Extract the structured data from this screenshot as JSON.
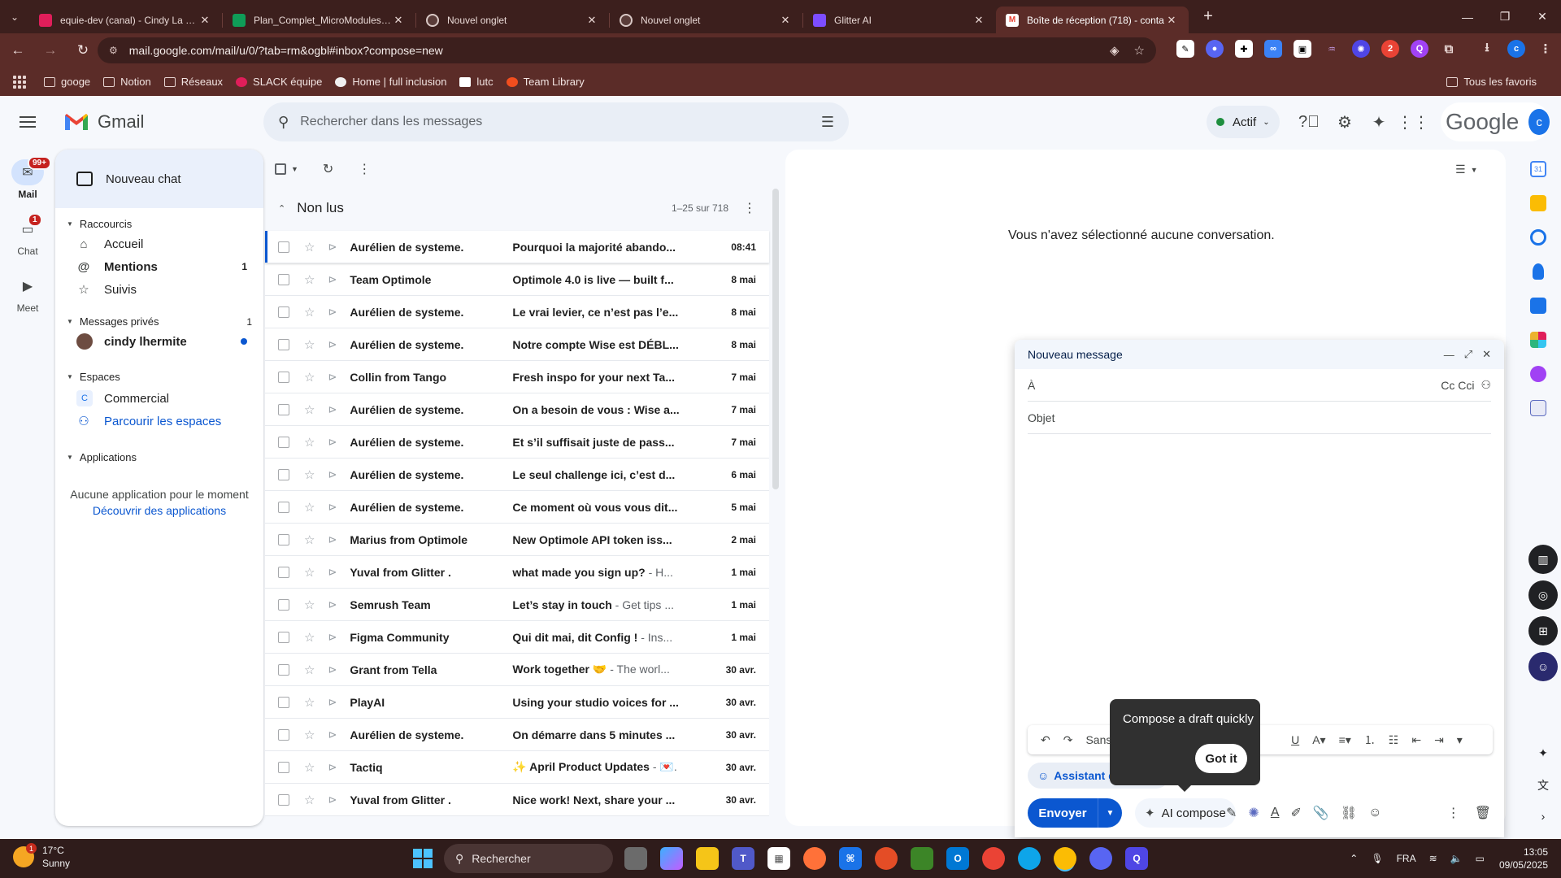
{
  "browser": {
    "tabs": [
      {
        "title": "equie-dev (canal) - Cindy La Ge",
        "favicon": "#e01e5a"
      },
      {
        "title": "Plan_Complet_MicroModules_C",
        "favicon": "#0f9d58"
      },
      {
        "title": "Nouvel onglet",
        "favicon": "#9e9e9e"
      },
      {
        "title": "Nouvel onglet",
        "favicon": "#9e9e9e"
      },
      {
        "title": "Glitter AI",
        "favicon": "#7c4dff"
      },
      {
        "title": "Boîte de réception (718) - conta",
        "favicon": "#ea4335"
      }
    ],
    "url": "mail.google.com/mail/u/0/?tab=rm&ogbl#inbox?compose=new",
    "bookmarks": [
      "googe",
      "Notion",
      "Réseaux",
      "SLACK équipe",
      "Home | full inclusion",
      "lutc",
      "Team Library"
    ],
    "all_bookmarks": "Tous les favoris",
    "profile_initial": "c"
  },
  "header": {
    "app_name": "Gmail",
    "search_placeholder": "Rechercher dans les messages",
    "status": "Actif",
    "google_wordmark": "Google",
    "avatar_initial": "c"
  },
  "rail": {
    "mail_label": "Mail",
    "mail_badge": "99+",
    "chat_label": "Chat",
    "chat_badge": "1",
    "meet_label": "Meet"
  },
  "chat": {
    "new_chat": "Nouveau chat",
    "shortcuts_title": "Raccourcis",
    "shortcuts": [
      {
        "label": "Accueil",
        "count": ""
      },
      {
        "label": "Mentions",
        "count": "1"
      },
      {
        "label": "Suivis",
        "count": ""
      }
    ],
    "dm_title": "Messages privés",
    "dm_count": "1",
    "dm_contact": "cindy lhermite",
    "spaces_title": "Espaces",
    "space_name": "Commercial",
    "space_initial": "C",
    "browse_spaces": "Parcourir les espaces",
    "apps_title": "Applications",
    "no_apps": "Aucune application pour le moment",
    "discover_apps": "Découvrir des applications"
  },
  "list": {
    "section_title": "Non lus",
    "range": "1–25 sur 718",
    "rows": [
      {
        "from": "Aurélien de systeme.",
        "subject": "Pourquoi la majorité abando...",
        "snippet": "",
        "date": "08:41"
      },
      {
        "from": "Team Optimole",
        "subject": "Optimole 4.0 is live — built f...",
        "snippet": "",
        "date": "8 mai"
      },
      {
        "from": "Aurélien de systeme.",
        "subject": "Le vrai levier, ce n’est pas l’e...",
        "snippet": "",
        "date": "8 mai"
      },
      {
        "from": "Aurélien de systeme.",
        "subject": "Notre compte Wise est DÉBL...",
        "snippet": "",
        "date": "8 mai"
      },
      {
        "from": "Collin from Tango",
        "subject": "Fresh inspo for your next Ta...",
        "snippet": "",
        "date": "7 mai"
      },
      {
        "from": "Aurélien de systeme.",
        "subject": "On a besoin de vous : Wise a...",
        "snippet": "",
        "date": "7 mai"
      },
      {
        "from": "Aurélien de systeme.",
        "subject": "Et s’il suffisait juste de pass...",
        "snippet": "",
        "date": "7 mai"
      },
      {
        "from": "Aurélien de systeme.",
        "subject": "Le seul challenge ici, c’est d...",
        "snippet": "",
        "date": "6 mai"
      },
      {
        "from": "Aurélien de systeme.",
        "subject": "Ce moment où vous vous dit...",
        "snippet": "",
        "date": "5 mai"
      },
      {
        "from": "Marius from Optimole",
        "subject": "New Optimole API token iss...",
        "snippet": "",
        "date": "2 mai"
      },
      {
        "from": "Yuval from Glitter .",
        "subject": "what made you sign up?",
        "snippet": " - H...",
        "date": "1 mai"
      },
      {
        "from": "Semrush Team",
        "subject": "Let’s stay in touch",
        "snippet": " - Get tips ...",
        "date": "1 mai"
      },
      {
        "from": "Figma Community",
        "subject": "Qui dit mai, dit Config !",
        "snippet": " - Ins...",
        "date": "1 mai"
      },
      {
        "from": "Grant from Tella",
        "subject": "Work together 🤝",
        "snippet": " - The worl...",
        "date": "30 avr."
      },
      {
        "from": "PlayAI",
        "subject": "Using your studio voices for ...",
        "snippet": "",
        "date": "30 avr."
      },
      {
        "from": "Aurélien de systeme.",
        "subject": "On démarre dans 5 minutes ...",
        "snippet": "",
        "date": "30 avr."
      },
      {
        "from": "Tactiq",
        "subject": "✨ April Product Updates",
        "snippet": " - 💌.",
        "date": "30 avr."
      },
      {
        "from": "Yuval from Glitter .",
        "subject": "Nice work! Next, share your ...",
        "snippet": "",
        "date": "30 avr."
      }
    ]
  },
  "reading_pane": {
    "empty": "Vous n'avez sélectionné aucune conversation."
  },
  "compose": {
    "title": "Nouveau message",
    "to_label": "À",
    "cc_label": "Cc Cci",
    "subject_placeholder": "Objet",
    "font": "Sans Serif",
    "assistant": "Assistant d'écriture",
    "send": "Envoyer",
    "ai_compose": "AI compose"
  },
  "tooltip": {
    "text": "Compose a draft quickly",
    "button": "Got it"
  },
  "taskbar": {
    "temp": "17°C",
    "weather": "Sunny",
    "weather_badge": "1",
    "search": "Rechercher",
    "lang": "FRA",
    "time": "13:05",
    "date": "09/05/2025"
  }
}
